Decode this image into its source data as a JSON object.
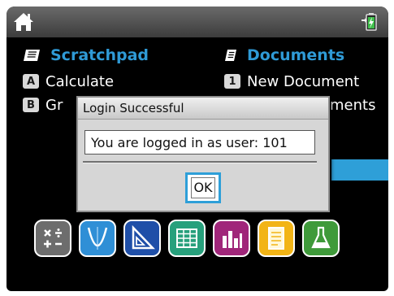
{
  "home": {
    "scratchpad": {
      "title": "Scratchpad",
      "items": [
        {
          "key": "A",
          "label": "Calculate"
        },
        {
          "key": "B",
          "label": "Gr"
        }
      ]
    },
    "documents": {
      "title": "Documents",
      "items": [
        {
          "key": "1",
          "label": "New Document"
        },
        {
          "key": "",
          "label": "ments"
        }
      ]
    }
  },
  "apps": [
    {
      "icon": "calculator-icon",
      "color": "#6d6d6d"
    },
    {
      "icon": "graphs-icon",
      "color": "#2f8fd6"
    },
    {
      "icon": "geometry-icon",
      "color": "#1f4fa8"
    },
    {
      "icon": "lists-spreadsheet-icon",
      "color": "#27a07c"
    },
    {
      "icon": "data-statistics-icon",
      "color": "#a0267a"
    },
    {
      "icon": "notes-icon",
      "color": "#f2b416"
    },
    {
      "icon": "vernier-dataquest-icon",
      "color": "#3f9a3a"
    }
  ],
  "dialog": {
    "title": "Login Successful",
    "message": "You are logged in as user: 101",
    "ok_label": "OK"
  },
  "colors": {
    "accent": "#2e9fd8",
    "heading": "#2f9ad6"
  }
}
